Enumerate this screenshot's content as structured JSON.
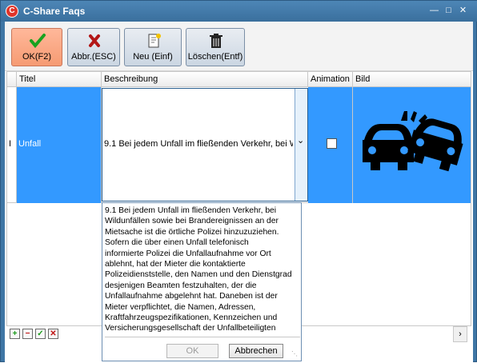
{
  "window": {
    "title": "C-Share Faqs",
    "icon_letter": "C"
  },
  "toolbar": {
    "ok_label": "OK(F2)",
    "cancel_label": "Abbr.(ESC)",
    "new_label": "Neu (Einf)",
    "delete_label": "Löschen(Entf)"
  },
  "grid": {
    "columns": [
      "Titel",
      "Beschreibung",
      "Animation",
      "Bild"
    ],
    "rows": [
      {
        "titel": "Unfall",
        "beschreibung": "9.1 Bei jedem Unfall im fließenden Verkehr, bei Wi",
        "animation": false,
        "bild_icon": "car-crash-icon"
      }
    ]
  },
  "popup": {
    "text": "9.1 Bei jedem Unfall im fließenden Verkehr, bei\nWildunfällen sowie bei Brandereignissen an der\nMietsache ist die örtliche Polizei hinzuzuziehen.\nSofern die über einen Unfall telefonisch\ninformierte Polizei die Unfallaufnahme vor Ort\nablehnt, hat der Mieter die kontaktierte\nPolizeidienststelle, den Namen und den Dienstgrad\ndesjenigen Beamten festzuhalten, der die\nUnfallaufnahme abgelehnt hat. Daneben ist der\nMieter verpflichtet, die Namen, Adressen,\nKraftfahrzeugspezifikationen, Kennzeichen und\nVersicherungsgesellschaft der Unfallbeteiligten",
    "ok_label": "OK",
    "cancel_label": "Abbrechen"
  },
  "colors": {
    "selection": "#3399ff",
    "primary_button": "#f69b73",
    "title_bar": "#3f76a5"
  }
}
